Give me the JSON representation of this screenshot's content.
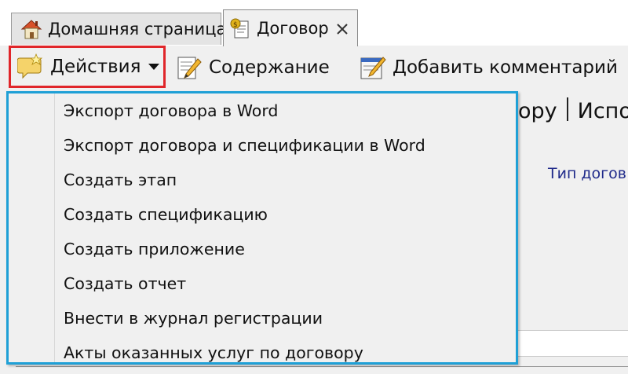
{
  "tabs": [
    {
      "label": "Домашняя страница",
      "icon": "home-icon",
      "active": false
    },
    {
      "label": "Договор",
      "icon": "contract-icon",
      "active": true
    }
  ],
  "toolbar": {
    "actions_label": "Действия",
    "content_label": "Содержание",
    "comment_label": "Добавить комментарий"
  },
  "menu": {
    "items": [
      {
        "label": "Экспорт договора в Word"
      },
      {
        "label": "Экспорт договора и спецификации в Word"
      },
      {
        "label": "Создать этап"
      },
      {
        "label": "Создать спецификацию"
      },
      {
        "label": "Создать приложение"
      },
      {
        "label": "Создать отчет"
      },
      {
        "label": "Внести в журнал регистрации"
      },
      {
        "label": "Акты оказанных услуг по договору"
      }
    ]
  },
  "background": {
    "tab_fragment_1": "ору",
    "tab_fragment_2": "Испо",
    "field_label_fragment": "Тип догов"
  },
  "colors": {
    "highlight_red": "#e0262a",
    "menu_border_blue": "#1fa0d6",
    "label_blue": "#1f2a8a"
  }
}
